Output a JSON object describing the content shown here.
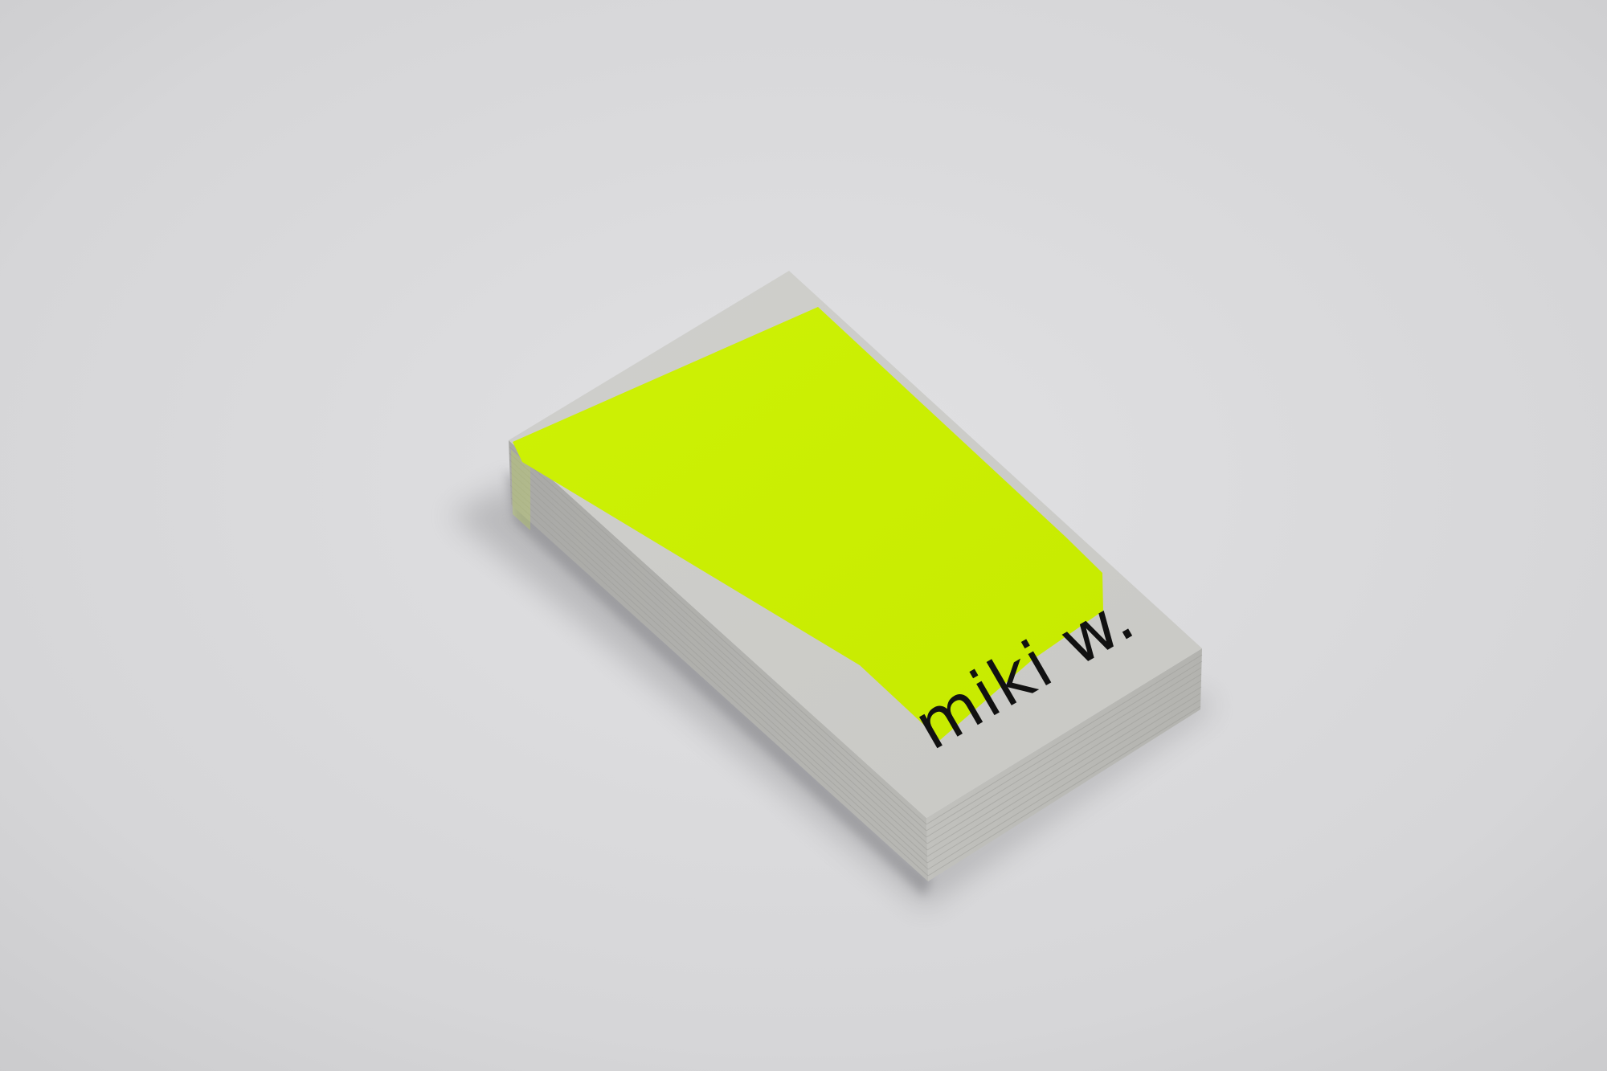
{
  "card": {
    "name_text": "miki w."
  },
  "colors": {
    "backdrop": "#d7d7d9",
    "card_face": "#ccccc9",
    "card_edge": "#b9b9b5",
    "neon_block": "#ccf000",
    "ink": "#111111"
  }
}
